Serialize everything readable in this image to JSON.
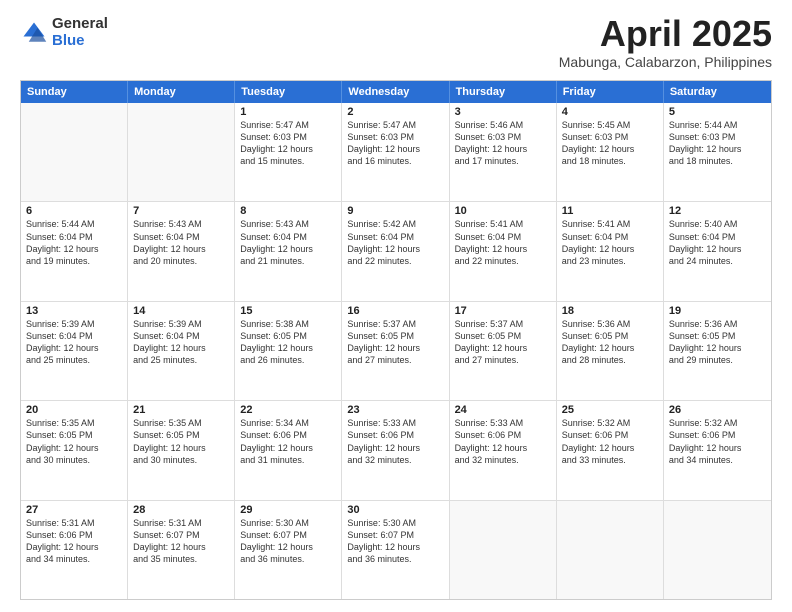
{
  "logo": {
    "general": "General",
    "blue": "Blue"
  },
  "header": {
    "month": "April 2025",
    "location": "Mabunga, Calabarzon, Philippines"
  },
  "weekdays": [
    "Sunday",
    "Monday",
    "Tuesday",
    "Wednesday",
    "Thursday",
    "Friday",
    "Saturday"
  ],
  "weeks": [
    [
      {
        "day": "",
        "lines": []
      },
      {
        "day": "",
        "lines": []
      },
      {
        "day": "1",
        "lines": [
          "Sunrise: 5:47 AM",
          "Sunset: 6:03 PM",
          "Daylight: 12 hours",
          "and 15 minutes."
        ]
      },
      {
        "day": "2",
        "lines": [
          "Sunrise: 5:47 AM",
          "Sunset: 6:03 PM",
          "Daylight: 12 hours",
          "and 16 minutes."
        ]
      },
      {
        "day": "3",
        "lines": [
          "Sunrise: 5:46 AM",
          "Sunset: 6:03 PM",
          "Daylight: 12 hours",
          "and 17 minutes."
        ]
      },
      {
        "day": "4",
        "lines": [
          "Sunrise: 5:45 AM",
          "Sunset: 6:03 PM",
          "Daylight: 12 hours",
          "and 18 minutes."
        ]
      },
      {
        "day": "5",
        "lines": [
          "Sunrise: 5:44 AM",
          "Sunset: 6:03 PM",
          "Daylight: 12 hours",
          "and 18 minutes."
        ]
      }
    ],
    [
      {
        "day": "6",
        "lines": [
          "Sunrise: 5:44 AM",
          "Sunset: 6:04 PM",
          "Daylight: 12 hours",
          "and 19 minutes."
        ]
      },
      {
        "day": "7",
        "lines": [
          "Sunrise: 5:43 AM",
          "Sunset: 6:04 PM",
          "Daylight: 12 hours",
          "and 20 minutes."
        ]
      },
      {
        "day": "8",
        "lines": [
          "Sunrise: 5:43 AM",
          "Sunset: 6:04 PM",
          "Daylight: 12 hours",
          "and 21 minutes."
        ]
      },
      {
        "day": "9",
        "lines": [
          "Sunrise: 5:42 AM",
          "Sunset: 6:04 PM",
          "Daylight: 12 hours",
          "and 22 minutes."
        ]
      },
      {
        "day": "10",
        "lines": [
          "Sunrise: 5:41 AM",
          "Sunset: 6:04 PM",
          "Daylight: 12 hours",
          "and 22 minutes."
        ]
      },
      {
        "day": "11",
        "lines": [
          "Sunrise: 5:41 AM",
          "Sunset: 6:04 PM",
          "Daylight: 12 hours",
          "and 23 minutes."
        ]
      },
      {
        "day": "12",
        "lines": [
          "Sunrise: 5:40 AM",
          "Sunset: 6:04 PM",
          "Daylight: 12 hours",
          "and 24 minutes."
        ]
      }
    ],
    [
      {
        "day": "13",
        "lines": [
          "Sunrise: 5:39 AM",
          "Sunset: 6:04 PM",
          "Daylight: 12 hours",
          "and 25 minutes."
        ]
      },
      {
        "day": "14",
        "lines": [
          "Sunrise: 5:39 AM",
          "Sunset: 6:04 PM",
          "Daylight: 12 hours",
          "and 25 minutes."
        ]
      },
      {
        "day": "15",
        "lines": [
          "Sunrise: 5:38 AM",
          "Sunset: 6:05 PM",
          "Daylight: 12 hours",
          "and 26 minutes."
        ]
      },
      {
        "day": "16",
        "lines": [
          "Sunrise: 5:37 AM",
          "Sunset: 6:05 PM",
          "Daylight: 12 hours",
          "and 27 minutes."
        ]
      },
      {
        "day": "17",
        "lines": [
          "Sunrise: 5:37 AM",
          "Sunset: 6:05 PM",
          "Daylight: 12 hours",
          "and 27 minutes."
        ]
      },
      {
        "day": "18",
        "lines": [
          "Sunrise: 5:36 AM",
          "Sunset: 6:05 PM",
          "Daylight: 12 hours",
          "and 28 minutes."
        ]
      },
      {
        "day": "19",
        "lines": [
          "Sunrise: 5:36 AM",
          "Sunset: 6:05 PM",
          "Daylight: 12 hours",
          "and 29 minutes."
        ]
      }
    ],
    [
      {
        "day": "20",
        "lines": [
          "Sunrise: 5:35 AM",
          "Sunset: 6:05 PM",
          "Daylight: 12 hours",
          "and 30 minutes."
        ]
      },
      {
        "day": "21",
        "lines": [
          "Sunrise: 5:35 AM",
          "Sunset: 6:05 PM",
          "Daylight: 12 hours",
          "and 30 minutes."
        ]
      },
      {
        "day": "22",
        "lines": [
          "Sunrise: 5:34 AM",
          "Sunset: 6:06 PM",
          "Daylight: 12 hours",
          "and 31 minutes."
        ]
      },
      {
        "day": "23",
        "lines": [
          "Sunrise: 5:33 AM",
          "Sunset: 6:06 PM",
          "Daylight: 12 hours",
          "and 32 minutes."
        ]
      },
      {
        "day": "24",
        "lines": [
          "Sunrise: 5:33 AM",
          "Sunset: 6:06 PM",
          "Daylight: 12 hours",
          "and 32 minutes."
        ]
      },
      {
        "day": "25",
        "lines": [
          "Sunrise: 5:32 AM",
          "Sunset: 6:06 PM",
          "Daylight: 12 hours",
          "and 33 minutes."
        ]
      },
      {
        "day": "26",
        "lines": [
          "Sunrise: 5:32 AM",
          "Sunset: 6:06 PM",
          "Daylight: 12 hours",
          "and 34 minutes."
        ]
      }
    ],
    [
      {
        "day": "27",
        "lines": [
          "Sunrise: 5:31 AM",
          "Sunset: 6:06 PM",
          "Daylight: 12 hours",
          "and 34 minutes."
        ]
      },
      {
        "day": "28",
        "lines": [
          "Sunrise: 5:31 AM",
          "Sunset: 6:07 PM",
          "Daylight: 12 hours",
          "and 35 minutes."
        ]
      },
      {
        "day": "29",
        "lines": [
          "Sunrise: 5:30 AM",
          "Sunset: 6:07 PM",
          "Daylight: 12 hours",
          "and 36 minutes."
        ]
      },
      {
        "day": "30",
        "lines": [
          "Sunrise: 5:30 AM",
          "Sunset: 6:07 PM",
          "Daylight: 12 hours",
          "and 36 minutes."
        ]
      },
      {
        "day": "",
        "lines": []
      },
      {
        "day": "",
        "lines": []
      },
      {
        "day": "",
        "lines": []
      }
    ]
  ]
}
